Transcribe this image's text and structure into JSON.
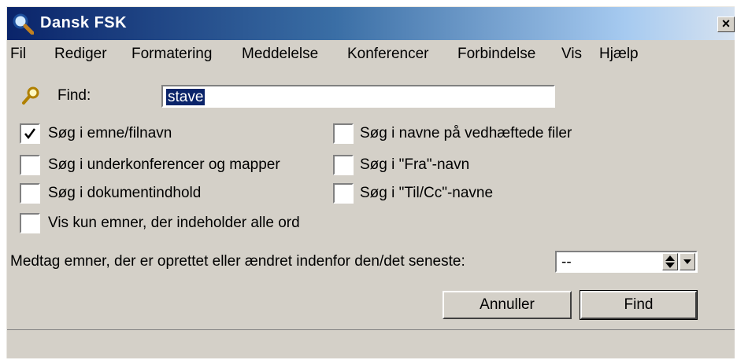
{
  "window": {
    "title": "Dansk FSK",
    "close_label": "×"
  },
  "menu": [
    "Fil",
    "Rediger",
    "Formatering",
    "Meddelelse",
    "Konferencer",
    "Forbindelse",
    "Vis",
    "Hjælp"
  ],
  "find": {
    "label": "Find:",
    "value": "stave"
  },
  "options": {
    "subject_filename": {
      "label": "Søg i emne/filnavn",
      "checked": true
    },
    "attachment_names": {
      "label": "Søg i navne på vedhæftede filer",
      "checked": false
    },
    "subconferences": {
      "label": "Søg i underkonferencer og mapper",
      "checked": false
    },
    "from_name": {
      "label": "Søg i \"Fra\"-navn",
      "checked": false
    },
    "document_content": {
      "label": "Søg i dokumentindhold",
      "checked": false
    },
    "to_cc_names": {
      "label": "Søg i \"Til/Cc\"-navne",
      "checked": false
    },
    "all_words": {
      "label": "Vis kun emner, der indeholder alle ord",
      "checked": false
    }
  },
  "date_filter": {
    "label": "Medtag emner, der er oprettet eller ændret indenfor den/det seneste:",
    "value": "--"
  },
  "buttons": {
    "cancel": "Annuller",
    "find": "Find"
  },
  "icons": {
    "app": "magnifier-icon",
    "find": "magnifier-icon",
    "spin": "spin-arrows-icon",
    "dropdown": "dropdown-arrow-icon"
  }
}
